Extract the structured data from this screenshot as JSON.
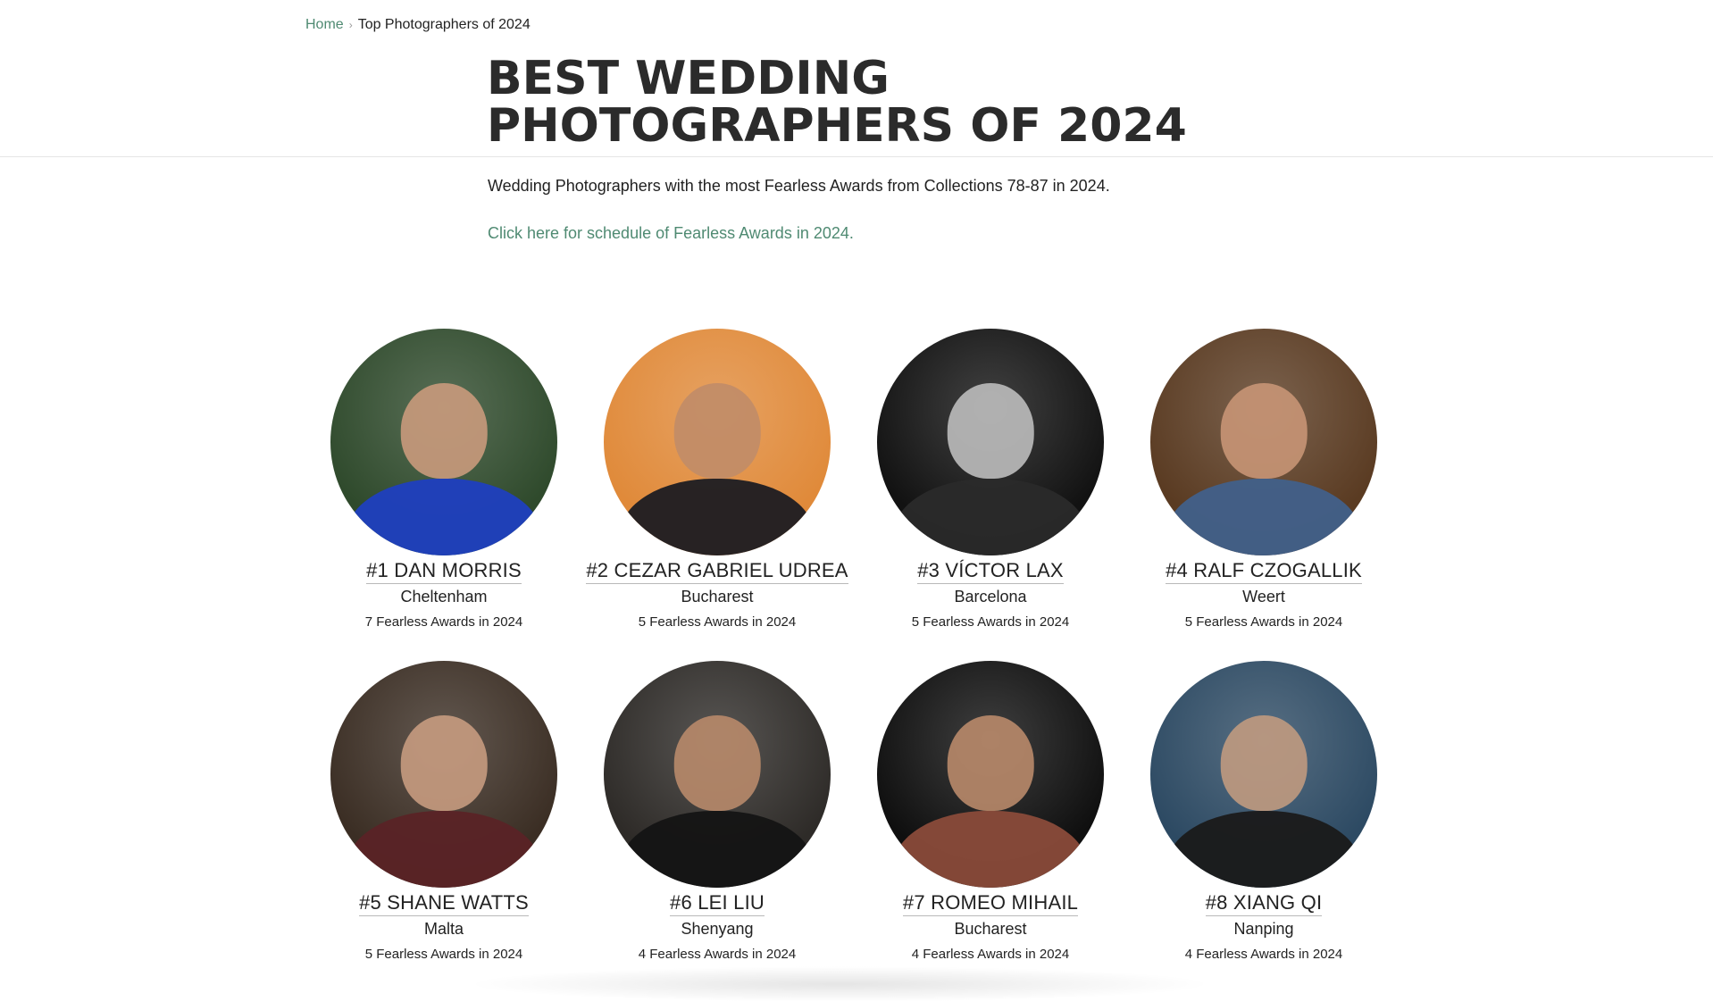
{
  "breadcrumb": {
    "home": "Home",
    "separator": "›",
    "current": "Top Photographers of 2024"
  },
  "title": {
    "line1": "BEST WEDDING",
    "line2": "PHOTOGRAPHERS OF 2024"
  },
  "intro": "Wedding Photographers with the most Fearless Awards from Collections 78-87 in 2024.",
  "schedule_link": "Click here for schedule of Fearless Awards in 2024.",
  "colors": {
    "accent": "#4f8a72",
    "title": "#2b2b2b",
    "text": "#222222"
  },
  "photographers": [
    {
      "name": "#1 DAN MORRIS",
      "city": "Cheltenham",
      "awards": "7 Fearless Awards in 2024",
      "bg": "#2f4a2c",
      "skin": "#c99a7c",
      "shirt": "#1f3fbf"
    },
    {
      "name": "#2 CEZAR GABRIEL UDREA",
      "city": "Bucharest",
      "awards": "5 Fearless Awards in 2024",
      "bg": "#e08a3a",
      "skin": "#c08c68",
      "shirt": "#1c1c22"
    },
    {
      "name": "#3 VÍCTOR LAX",
      "city": "Barcelona",
      "awards": "5 Fearless Awards in 2024",
      "bg": "#121212",
      "skin": "#bdbdbd",
      "shirt": "#2a2a2a"
    },
    {
      "name": "#4 RALF CZOGALLIK",
      "city": "Weert",
      "awards": "5 Fearless Awards in 2024",
      "bg": "#5a3b22",
      "skin": "#c89576",
      "shirt": "#41608a"
    },
    {
      "name": "#5 SHANE WATTS",
      "city": "Malta",
      "awards": "5 Fearless Awards in 2024",
      "bg": "#3b2e24",
      "skin": "#c79b80",
      "shirt": "#5a2326"
    },
    {
      "name": "#6 LEI LIU",
      "city": "Shenyang",
      "awards": "4 Fearless Awards in 2024",
      "bg": "#2e2b28",
      "skin": "#b8896a",
      "shirt": "#141414"
    },
    {
      "name": "#7 ROMEO MIHAIL",
      "city": "Bucharest",
      "awards": "4 Fearless Awards in 2024",
      "bg": "#0f0f0f",
      "skin": "#b98a6a",
      "shirt": "#8a4b3a"
    },
    {
      "name": "#8 XIANG QI",
      "city": "Nanping",
      "awards": "4 Fearless Awards in 2024",
      "bg": "#2d4a63",
      "skin": "#c09a80",
      "shirt": "#1a1a1a"
    }
  ]
}
